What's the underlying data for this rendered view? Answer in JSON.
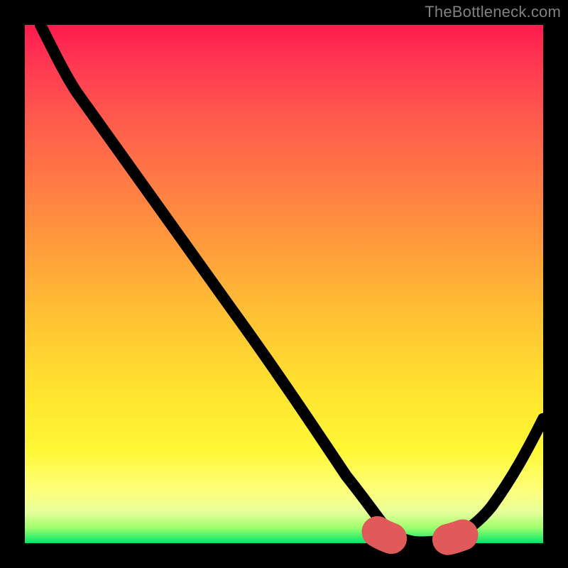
{
  "attribution": "TheBottleneck.com",
  "colors": {
    "frame": "#000000",
    "attribution": "#808080",
    "curve": "#000000",
    "min_marker": "#e05a5a",
    "gradient_top": "#ff1a4d",
    "gradient_bottom": "#00e66a"
  },
  "chart_data": {
    "type": "line",
    "title": "",
    "xlabel": "",
    "ylabel": "",
    "xlim": [
      0,
      100
    ],
    "ylim": [
      0,
      100
    ],
    "x": [
      0,
      5,
      10,
      15,
      20,
      25,
      30,
      35,
      40,
      45,
      50,
      55,
      60,
      65,
      68,
      72,
      75,
      78,
      80,
      85,
      90,
      95,
      100
    ],
    "y": [
      100,
      94,
      88,
      80,
      72,
      64,
      56,
      48,
      40,
      32,
      24,
      17,
      11,
      6,
      3,
      1,
      0,
      0,
      0,
      1,
      5,
      13,
      24
    ],
    "annotations": {
      "min_region_x": [
        68,
        85
      ],
      "min_region_y": 0
    },
    "notes": "Axes are unlabelled; values are positional estimates on a 0–100 normalized scale derived from the image. The curve descends steeply from the top-left, bottoms out around x≈75–80, and rises toward the right edge. A dashed salmon marker highlights the minimum region."
  }
}
